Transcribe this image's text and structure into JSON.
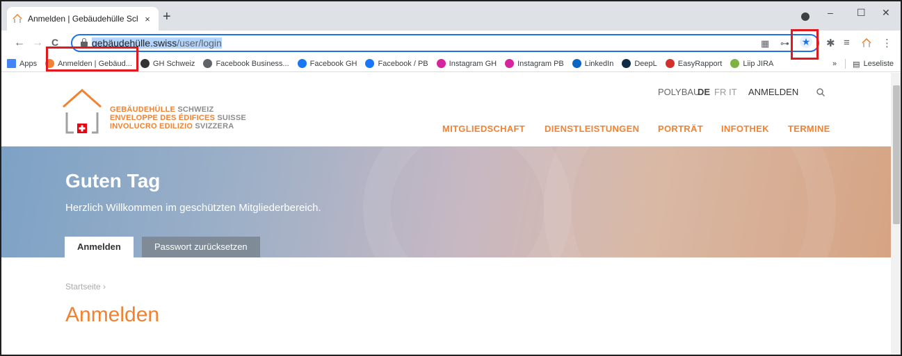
{
  "browser": {
    "tab_title": "Anmelden | Gebäudehülle Schwe",
    "tab_close": "×",
    "new_tab": "+",
    "window_controls": {
      "minimize": "–",
      "maximize": "☐",
      "close": "✕"
    },
    "nav": {
      "back": "←",
      "forward": "→",
      "reload": "C"
    },
    "url_host": "gebäudehülle.swiss",
    "url_path": "/user/login",
    "bookmarks": [
      {
        "label": "Apps",
        "icon": "apps-grid-icon",
        "color": "#4285f4"
      },
      {
        "label": "Anmelden | Gebäud...",
        "icon": "gh-house-icon",
        "color": "#f08231"
      },
      {
        "label": "GH Schweiz",
        "icon": "gh-icon",
        "color": "#333333"
      },
      {
        "label": "Facebook Business...",
        "icon": "facebook-business-icon",
        "color": "#5f6368"
      },
      {
        "label": "Facebook GH",
        "icon": "facebook-icon",
        "color": "#1877f2"
      },
      {
        "label": "Facebook / PB",
        "icon": "facebook-icon",
        "color": "#1877f2"
      },
      {
        "label": "Instagram GH",
        "icon": "instagram-icon",
        "color": "#d6249f"
      },
      {
        "label": "Instagram PB",
        "icon": "instagram-icon",
        "color": "#d6249f"
      },
      {
        "label": "LinkedIn",
        "icon": "linkedin-icon",
        "color": "#0a66c2"
      },
      {
        "label": "DeepL",
        "icon": "deepl-icon",
        "color": "#0f2b46"
      },
      {
        "label": "EasyRapport",
        "icon": "easyrapport-icon",
        "color": "#d0312d"
      },
      {
        "label": "Liip JIRA",
        "icon": "jira-icon",
        "color": "#7cb342"
      }
    ],
    "bookmarks_more": "»",
    "reading_list": "Leseliste"
  },
  "site": {
    "logo": {
      "line1_bold": "GEBÄUDEHÜLLE",
      "line1_rest": "SCHWEIZ",
      "line2_bold": "ENVELOPPE DES ÉDIFICES",
      "line2_rest": "SUISSE",
      "line3_bold": "INVOLUCRO EDILIZIO",
      "line3_rest": "SVIZZERA"
    },
    "top_nav": {
      "polybau": "POLYBAU",
      "de": "DE",
      "fr": "FR",
      "it": "IT",
      "login": "ANMELDEN"
    },
    "main_nav": [
      "MITGLIEDSCHAFT",
      "DIENSTLEISTUNGEN",
      "PORTRÄT",
      "INFOTHEK",
      "TERMINE"
    ],
    "hero": {
      "title": "Guten Tag",
      "subtitle": "Herzlich Willkommen im geschützten Mitgliederbereich.",
      "tab_active": "Anmelden",
      "tab_inactive": "Passwort zurücksetzen"
    },
    "breadcrumb": "Startseite  ›",
    "page_title": "Anmelden",
    "accent_color": "#f08231"
  }
}
